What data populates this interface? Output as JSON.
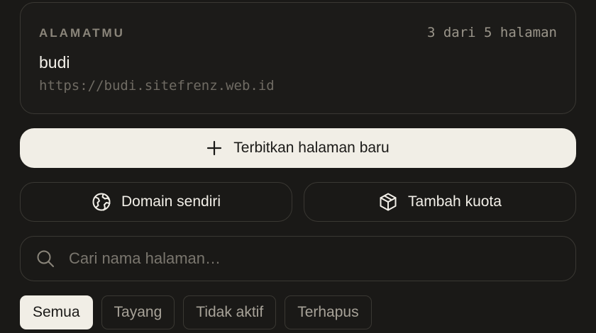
{
  "address_card": {
    "label": "ALAMATMU",
    "page_count": "3 dari 5 halaman",
    "name": "budi",
    "url": "https://budi.sitefrenz.web.id"
  },
  "actions": {
    "publish_label": "Terbitkan halaman baru",
    "publish_icon": "plus-icon",
    "domain_label": "Domain sendiri",
    "domain_icon": "globe-icon",
    "quota_label": "Tambah kuota",
    "quota_icon": "box-icon"
  },
  "search": {
    "placeholder": "Cari nama halaman…",
    "value": "",
    "icon": "search-icon"
  },
  "filters": [
    {
      "label": "Semua",
      "active": true
    },
    {
      "label": "Tayang",
      "active": false
    },
    {
      "label": "Tidak aktif",
      "active": false
    },
    {
      "label": "Terhapus",
      "active": false
    }
  ],
  "colors": {
    "background": "#1a1917",
    "accent": "#f1eee6",
    "border": "#3a3833"
  }
}
